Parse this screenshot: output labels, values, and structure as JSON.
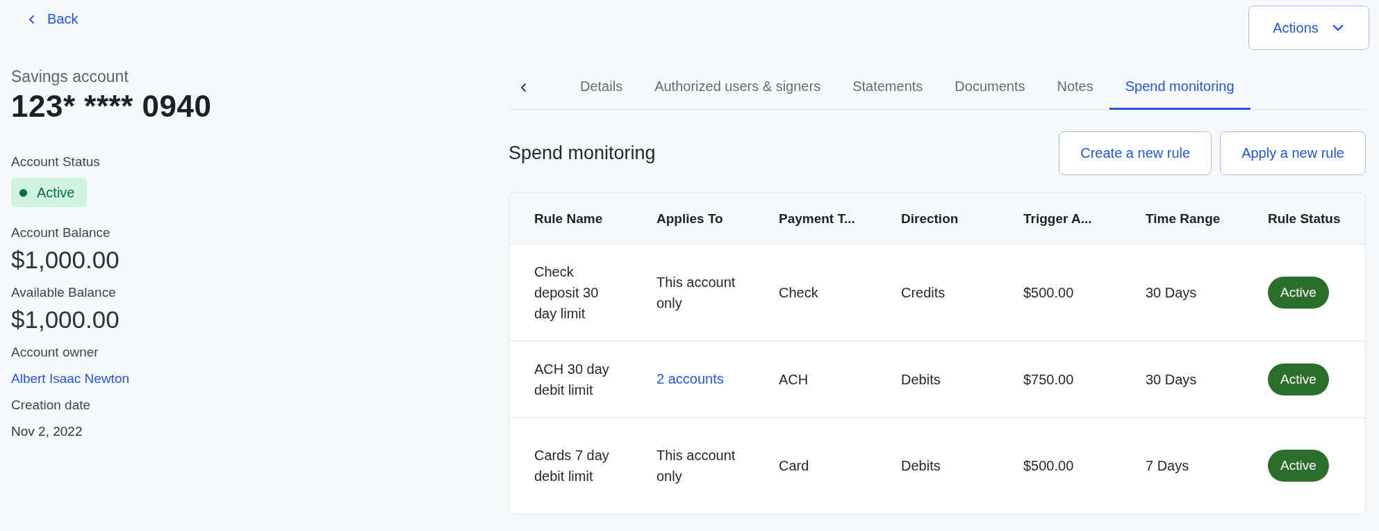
{
  "back": {
    "label": "Back"
  },
  "actions": {
    "label": "Actions"
  },
  "account": {
    "type": "Savings account",
    "number": "123* **** 0940",
    "status": {
      "label": "Account Status",
      "value": "Active"
    },
    "fields": [
      {
        "kind": "money",
        "label": "Account Balance",
        "value": "$1,000.00"
      },
      {
        "kind": "money",
        "label": "Available Balance",
        "value": "$1,000.00"
      },
      {
        "kind": "link",
        "label": "Account owner",
        "value": "Albert Isaac Newton"
      },
      {
        "kind": "text",
        "label": "Creation date",
        "value": "Nov 2, 2022"
      }
    ]
  },
  "tabs": [
    {
      "label": "Details",
      "selected": false
    },
    {
      "label": "Authorized users & signers",
      "selected": false
    },
    {
      "label": "Statements",
      "selected": false
    },
    {
      "label": "Documents",
      "selected": false
    },
    {
      "label": "Notes",
      "selected": false
    },
    {
      "label": "Spend monitoring",
      "selected": true
    }
  ],
  "section": {
    "title": "Spend monitoring",
    "buttons": [
      "Create a new rule",
      "Apply a new rule"
    ]
  },
  "table": {
    "columns": [
      "Rule Name",
      "Applies To",
      "Payment T...",
      "Direction",
      "Trigger A...",
      "Time Range",
      "Rule Status"
    ],
    "rows": [
      {
        "rule_name": "Check deposit 30 day limit",
        "applies_to": {
          "kind": "text",
          "value": "This account only"
        },
        "payment_type": "Check",
        "direction": "Credits",
        "trigger_amount": "$500.00",
        "time_range": "30 Days",
        "status": "Active"
      },
      {
        "rule_name": "ACH 30 day debit limit",
        "applies_to": {
          "kind": "link",
          "value": "2 accounts"
        },
        "payment_type": "ACH",
        "direction": "Debits",
        "trigger_amount": "$750.00",
        "time_range": "30 Days",
        "status": "Active"
      },
      {
        "rule_name": "Cards 7 day debit limit",
        "applies_to": {
          "kind": "text",
          "value": "This account only"
        },
        "payment_type": "Card",
        "direction": "Debits",
        "trigger_amount": "$500.00",
        "time_range": "7 Days",
        "status": "Active"
      }
    ]
  }
}
